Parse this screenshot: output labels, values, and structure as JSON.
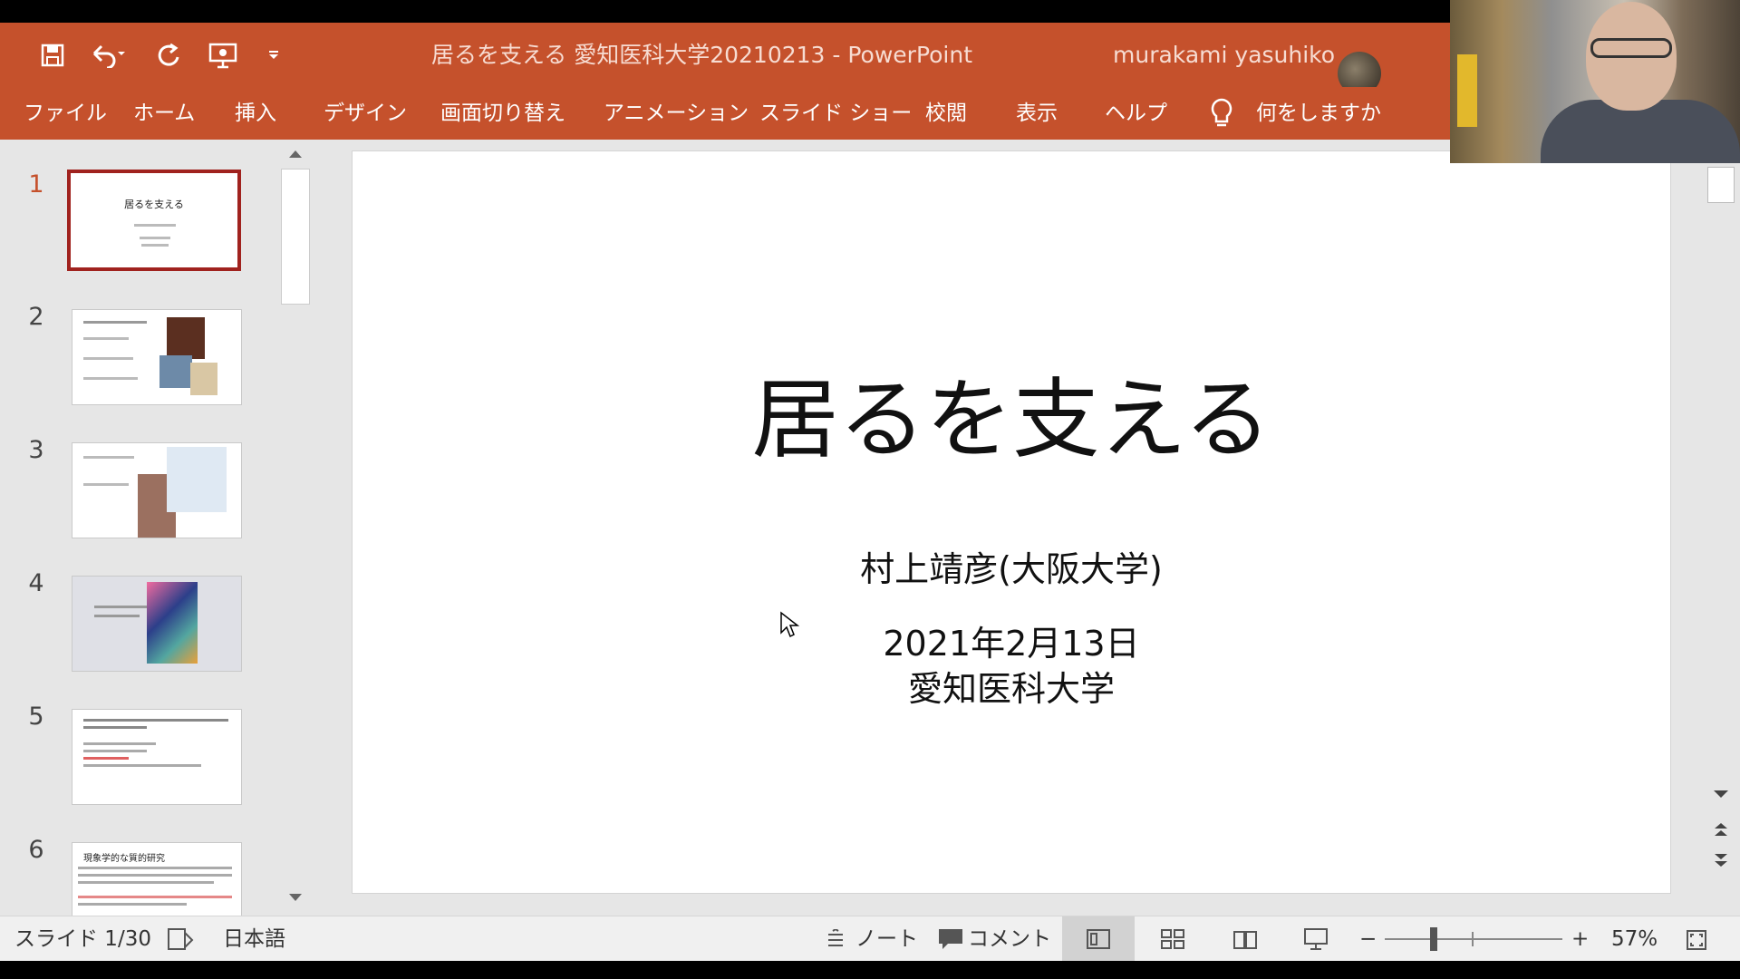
{
  "window": {
    "document_title": "居るを支える 愛知医科大学20210213 - PowerPoint",
    "user_name": "murakami yasuhiko",
    "quick_access": [
      "save-icon",
      "undo-icon",
      "redo-icon",
      "present-icon",
      "customize-icon"
    ]
  },
  "ribbon": {
    "tabs": [
      "ファイル",
      "ホーム",
      "挿入",
      "デザイン",
      "画面切り替え",
      "アニメーション",
      "スライド ショー",
      "校閲",
      "表示",
      "ヘルプ"
    ],
    "tell_me": "何をしますか"
  },
  "thumbnails": {
    "numbers": [
      "1",
      "2",
      "3",
      "4",
      "5",
      "6"
    ],
    "slide1_title": "居るを支える",
    "slide6_heading": "現象学的な質的研究"
  },
  "slide": {
    "title": "居るを支える",
    "author": "村上靖彦(大阪大学)",
    "date": "2021年2月13日",
    "org": "愛知医科大学"
  },
  "status": {
    "slide_count": "スライド 1/30",
    "language": "日本語",
    "notes": "ノート",
    "comments": "コメント",
    "zoom": "57%"
  },
  "colors": {
    "accent": "#c5512c",
    "active_thumb": "#a0221e"
  }
}
